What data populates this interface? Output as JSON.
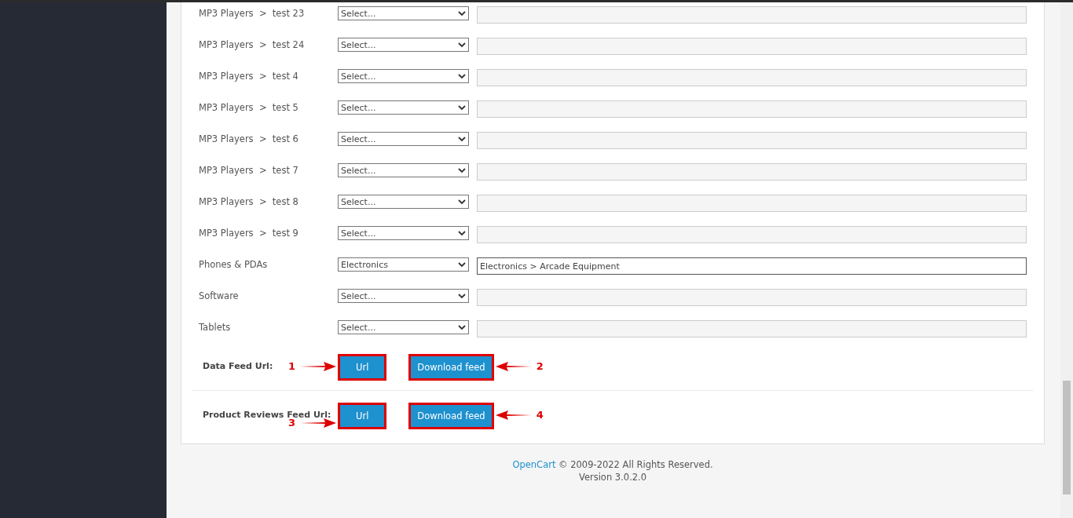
{
  "categories": [
    {
      "label": "MP3 Players  >  test 23",
      "select": "Select..."
    },
    {
      "label": "MP3 Players  >  test 24",
      "select": "Select..."
    },
    {
      "label": "MP3 Players  >  test 4",
      "select": "Select..."
    },
    {
      "label": "MP3 Players  >  test 5",
      "select": "Select..."
    },
    {
      "label": "MP3 Players  >  test 6",
      "select": "Select..."
    },
    {
      "label": "MP3 Players  >  test 7",
      "select": "Select..."
    },
    {
      "label": "MP3 Players  >  test 8",
      "select": "Select..."
    },
    {
      "label": "MP3 Players  >  test 9",
      "select": "Select..."
    },
    {
      "label": "Phones & PDAs",
      "select": "Electronics",
      "mapping": "Electronics > Arcade Equipment"
    },
    {
      "label": "Software",
      "select": "Select..."
    },
    {
      "label": "Tablets",
      "select": "Select..."
    }
  ],
  "feeds": [
    {
      "label": "Data Feed Url:",
      "buttons": [
        {
          "label": "Url",
          "outlined": true,
          "marker": {
            "number": "1",
            "kind": "left"
          }
        },
        {
          "label": "Download feed",
          "outlined": true,
          "marker": {
            "number": "2",
            "kind": "right"
          }
        }
      ]
    },
    {
      "label": "Product Reviews Feed Url:",
      "buttons": [
        {
          "label": "Url",
          "outlined": true,
          "marker": {
            "number": "3",
            "kind": "left"
          }
        },
        {
          "label": "Download feed",
          "outlined": true,
          "marker": {
            "number": "4",
            "kind": "right"
          }
        }
      ]
    }
  ],
  "footer": {
    "link": "OpenCart",
    "copyright": "© 2009-2022 All Rights Reserved.",
    "version": "Version 3.0.2.0"
  }
}
